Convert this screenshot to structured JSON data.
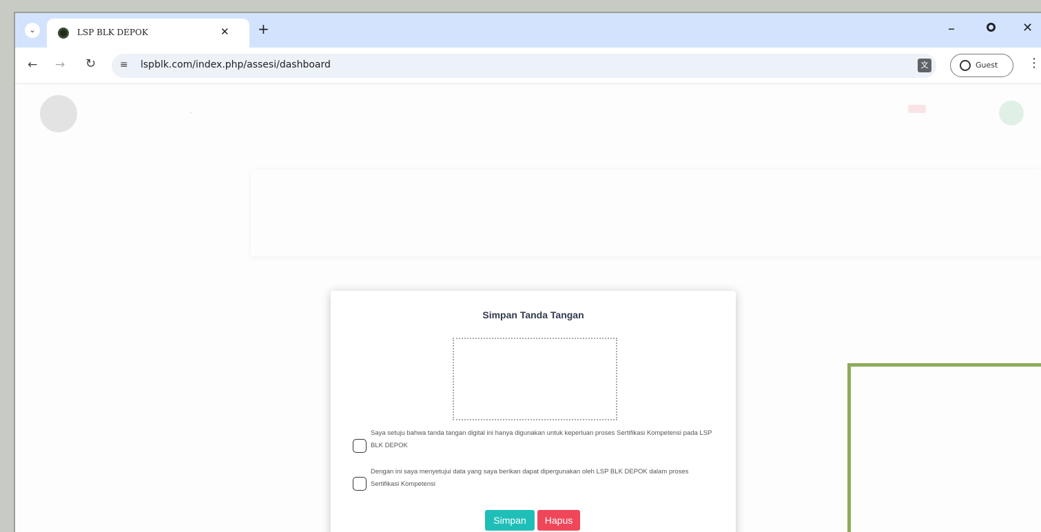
{
  "browser": {
    "tab_title": "LSP BLK DEPOK",
    "url": "lspblk.com/index.php/assesi/dashboard",
    "profile_label": "Guest"
  },
  "modal": {
    "title": "Simpan Tanda Tangan",
    "consent_1": "Saya setuju bahwa tanda tangan digital ini hanya digunakan untuk keperluan proses Sertifikasi Kompetensi pada LSP BLK DEPOK",
    "consent_2": "Dengan ini saya menyetujui data yang saya berikan dapat dipergunakan oleh LSP BLK DEPOK dalam proses Sertifikasi Kompetensi",
    "save_label": "Simpan",
    "clear_label": "Hapus"
  },
  "colors": {
    "tab_strip": "#d3e3fd",
    "save_button": "#1fbfb8",
    "clear_button": "#f0465a",
    "highlight_box": "#8fab5a"
  }
}
